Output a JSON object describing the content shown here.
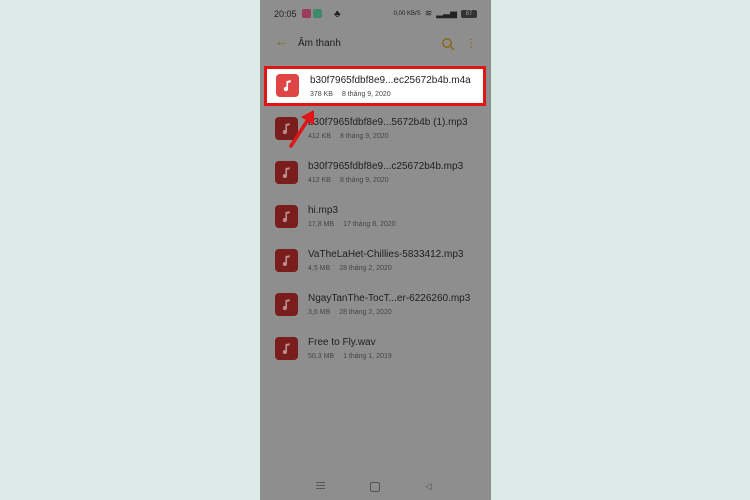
{
  "status_bar": {
    "time": "20:05",
    "speed": "0,00 KB/S",
    "battery": "87"
  },
  "app_bar": {
    "title": "Âm thanh",
    "back_icon": "back-arrow-icon",
    "search_icon": "search-icon",
    "more_icon": "more-vertical-icon"
  },
  "files": [
    {
      "name": "b30f7965fdbf8e9...ec25672b4b.m4a",
      "size": "378 KB",
      "date": "8 tháng 9, 2020",
      "selected": true
    },
    {
      "name": "b30f7965fdbf8e9...5672b4b (1).mp3",
      "size": "412 KB",
      "date": "8 tháng 9, 2020"
    },
    {
      "name": "b30f7965fdbf8e9...c25672b4b.mp3",
      "size": "412 KB",
      "date": "8 tháng 9, 2020"
    },
    {
      "name": "hi.mp3",
      "size": "17,8 MB",
      "date": "17 tháng 8, 2020"
    },
    {
      "name": "VaTheLaHet-Chillies-5833412.mp3",
      "size": "4,5 MB",
      "date": "28 tháng 2, 2020"
    },
    {
      "name": "NgayTanThe-TocT...er-6226260.mp3",
      "size": "3,6 MB",
      "date": "28 tháng 2, 2020"
    },
    {
      "name": "Free to Fly.wav",
      "size": "50,3 MB",
      "date": "1 tháng 1, 2019"
    }
  ],
  "colors": {
    "page_background": "#dceae8",
    "dim_overlay": "#8e8e8e",
    "accent": "#8a6a1c",
    "file_icon": "#e04545",
    "highlight": "#e01515"
  }
}
